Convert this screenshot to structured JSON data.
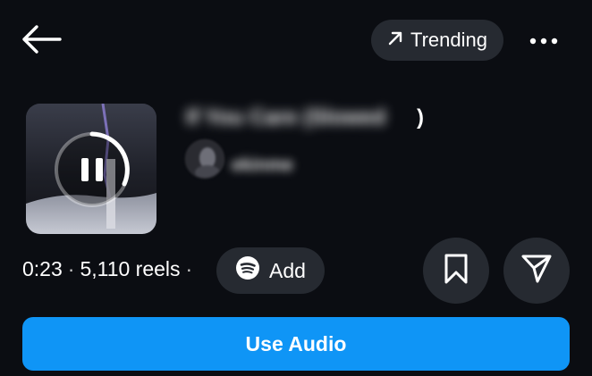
{
  "header": {
    "back_icon": "arrow-left-icon",
    "trending_label": "Trending",
    "trending_icon": "arrow-up-right-icon",
    "more_icon": "more-horizontal-icon"
  },
  "track": {
    "title": "If You Care (Slowed",
    "title_suffix": ")",
    "artist": "ekinme",
    "playback_state_icon": "pause-icon"
  },
  "meta": {
    "duration": "0:23",
    "separator": "·",
    "reels_count": "5,110 reels",
    "add_label": "Add",
    "add_icon": "spotify-icon"
  },
  "actions": {
    "save_icon": "bookmark-icon",
    "share_icon": "send-icon",
    "use_audio_label": "Use Audio"
  },
  "colors": {
    "background": "#0b0d12",
    "chip": "#262a31",
    "primary": "#0f95f6"
  }
}
